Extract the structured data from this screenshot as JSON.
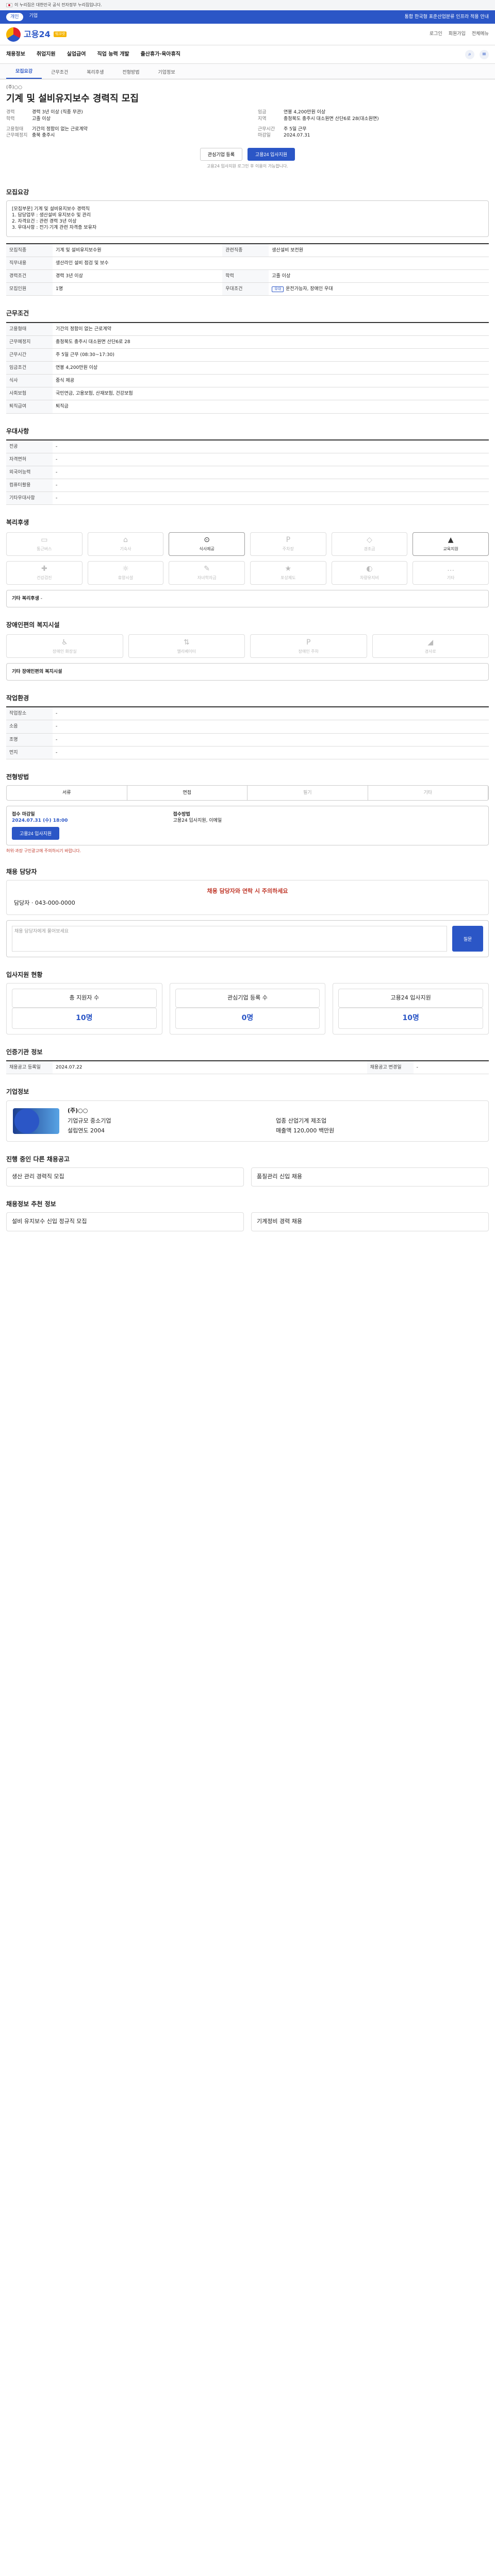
{
  "gov": {
    "text": "이 누리집은 대한민국 공식 전자정부 누리집입니다."
  },
  "topbar": {
    "tabs": [
      "개인",
      "기업"
    ],
    "right": "통합 한국형 표준산업분류 인프라 적용 안내"
  },
  "header": {
    "logo": "고용24",
    "badge": "워크넷",
    "links": [
      "로그인",
      "회원가입",
      "전체메뉴"
    ]
  },
  "gnb": {
    "items": [
      "채용정보",
      "취업지원",
      "실업급여",
      "직업 능력 개발",
      "출산휴가·육아휴직"
    ],
    "side": [
      "검색",
      "메뉴"
    ]
  },
  "tabs": [
    "모집요강",
    "근무조건",
    "복리후생",
    "전형방법",
    "기업정보"
  ],
  "job": {
    "company": "(주)○○",
    "title": "기계 및 설비유지보수 경력직 모집",
    "left": [
      [
        "경력",
        "경력 3년 이상 (직종 무관)"
      ],
      [
        "학력",
        "고졸 이상"
      ],
      [
        "고용형태",
        "기간의 정함이 없는 근로계약"
      ],
      [
        "근무예정지",
        "충북 충주시"
      ]
    ],
    "right": [
      [
        "임금",
        "연봉 4,200만원 이상"
      ],
      [
        "지역",
        "충청북도 충주시 대소원면 산단6로 28(대소원면)"
      ],
      [
        "근무시간",
        "주 5일 근무"
      ],
      [
        "마감일",
        "2024.07.31"
      ]
    ],
    "scrap": "관심기업 등록",
    "apply": "고용24 입사지원",
    "notice": "고용24 입사지원 로그인 후 이용이 가능합니다."
  },
  "recruit": {
    "title": "모집요강",
    "desc": [
      "[모집부문] 기계 및 설비유지보수 경력직",
      "1. 담당업무 : 생산설비 유지보수 및 관리",
      "2. 자격요건 : 관련 경력 3년 이상",
      "3. 우대사항 : 전기·기계 관련 자격증 보유자"
    ],
    "rows": [
      [
        "모집직종",
        "기계 및 설비유지보수원"
      ],
      [
        "관련직종",
        "생산설비 보전원"
      ],
      [
        "직무내용",
        "생산라인 설비 점검 및 보수"
      ],
      [
        "경력조건",
        "경력 3년 이상"
      ],
      [
        "학력",
        "고졸 이상"
      ],
      [
        "모집인원",
        "1명"
      ],
      [
        "우대조건",
        "운전가능자, 장애인 우대"
      ]
    ]
  },
  "cond": {
    "title": "근무조건",
    "rows": [
      [
        "고용형태",
        "기간의 정함이 없는 근로계약"
      ],
      [
        "근무예정지",
        "충청북도 충주시 대소원면 산단6로 28"
      ],
      [
        "근무시간",
        "주 5일 근무 (08:30~17:30)"
      ],
      [
        "임금조건",
        "연봉 4,200만원 이상"
      ],
      [
        "식사",
        "중식 제공"
      ],
      [
        "사회보험",
        "국민연금, 고용보험, 산재보험, 건강보험"
      ],
      [
        "퇴직급여",
        "퇴직금"
      ]
    ]
  },
  "edu": {
    "title": "우대사항",
    "rows": [
      [
        "전공",
        "-"
      ],
      [
        "자격면허",
        "-"
      ],
      [
        "외국어능력",
        "-"
      ],
      [
        "컴퓨터활용",
        "-"
      ],
      [
        "기타우대사항",
        "-"
      ]
    ]
  },
  "welfare": {
    "title": "복리후생",
    "icons": [
      "통근버스",
      "기숙사",
      "식사제공",
      "주차장",
      "경조금",
      "교육지원",
      "건강검진",
      "휴양시설",
      "자녀학자금",
      "포상제도",
      "차량유지비",
      "기타"
    ],
    "other": "기타 복리후생",
    "other_val": "-"
  },
  "disab": {
    "title": "장애인편의 복지시설",
    "icons": [
      "장애인 화장실",
      "엘리베이터",
      "장애인 주차",
      "경사로"
    ],
    "other": "기타 장애인편의 복지시설"
  },
  "env": {
    "title": "작업환경",
    "rows": [
      [
        "작업장소",
        "-"
      ],
      [
        "소음",
        "-"
      ],
      [
        "조명",
        "-"
      ],
      [
        "먼지",
        "-"
      ]
    ]
  },
  "process": {
    "title": "전형방법",
    "steps": [
      "서류",
      "면접",
      "필기",
      "기타"
    ],
    "deadline_label": "접수 마감일",
    "deadline": "2024.07.31 (수) 18:00",
    "method_label": "접수방법",
    "method": "고용24 입사지원, 이메일",
    "apply": "고용24 입사지원",
    "warn": "허위·과장 구인광고에 주의하시기 바랍니다."
  },
  "contact": {
    "title": "채용 담당자",
    "head": "채용 담당자와 연락 시 주의하세요",
    "name": "담당자",
    "phone": "043-000-0000",
    "qa_title": "채용 담당자에게 물어보세요",
    "qa_btn": "질문"
  },
  "stats": {
    "title": "입사지원 현황",
    "items": [
      [
        "총 지원자 수",
        "10명"
      ],
      [
        "관심기업 등록 수",
        "0명"
      ],
      [
        "고용24 입사지원",
        "10명"
      ]
    ]
  },
  "statinfo": {
    "title": "인증기관 정보",
    "rows": [
      [
        "채용공고 등록일",
        "2024.07.22"
      ],
      [
        "채용공고 변경일",
        "-"
      ]
    ]
  },
  "corp": {
    "title": "기업정보",
    "name": "(주)○○",
    "rows": [
      [
        "기업규모",
        "중소기업"
      ],
      [
        "업종",
        "산업기계 제조업"
      ],
      [
        "설립연도",
        "2004"
      ],
      [
        "매출액",
        "120,000 백만원"
      ]
    ]
  },
  "footer_hire": {
    "title": "진행 중인 다른 채용공고",
    "items": [
      "생산 관리 경력직 모집",
      "품질관리 신입 채용"
    ]
  },
  "related": {
    "title": "채용정보 추천 정보",
    "items": [
      "설비 유지보수 신입 정규직 모집",
      "기계정비 경력 채용"
    ]
  }
}
